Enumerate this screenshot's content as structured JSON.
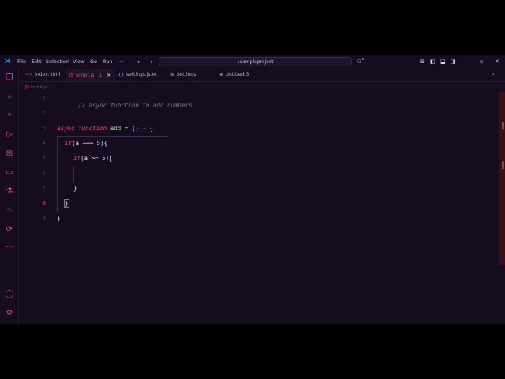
{
  "menu": {
    "file": "File",
    "edit": "Edit",
    "selection": "Selection",
    "view": "View",
    "go": "Go",
    "run": "Run",
    "more": "···"
  },
  "search": {
    "text": "sampleproject"
  },
  "window": {
    "minimize": "–",
    "restore": "▫",
    "close": "✕"
  },
  "tabs": [
    {
      "label": "index.html",
      "icon": "<>"
    },
    {
      "label": "script.js",
      "badge": "1",
      "icon": "JS",
      "close": "✕"
    },
    {
      "label": "settings.json",
      "icon": "{}"
    },
    {
      "label": "Settings",
      "icon": "≡"
    },
    {
      "label": "Untitled-3",
      "icon": "≡"
    }
  ],
  "breadcrumb": {
    "folder": "JS",
    "file": "script.js",
    "sep": "›"
  },
  "editor": {
    "line_numbers": [
      "1",
      "2",
      "3",
      "4",
      "5",
      "6",
      "7",
      "8",
      "9"
    ],
    "current_line": "8",
    "line1": {
      "comment": "// async function to add numbers"
    },
    "line3": {
      "kw1": "async",
      "kw2": "function",
      "name": "add",
      "rest": " = () ",
      "arrow": "⇒",
      "brace": " {"
    },
    "line4": {
      "kw": "if",
      "open": "(a ",
      "strike": "!==",
      "num": " 5",
      "close": "){"
    },
    "line5": {
      "kw": "if",
      "open": "(a >= ",
      "num": "5",
      "close": "){"
    },
    "line7": {
      "text": "}"
    },
    "line8": {
      "text": "}"
    },
    "line9": {
      "text": "}"
    }
  },
  "colors": {
    "accent": "#ff3d6e",
    "background": "#150d1f",
    "function": "#8fe38f",
    "comment": "#7b6f8e"
  },
  "activity_icons": [
    "files-icon",
    "search-icon",
    "source-control-icon",
    "run-debug-icon",
    "extensions-icon",
    "remote-icon",
    "testing-icon",
    "flame-icon",
    "git-icon",
    "more-icon",
    "account-icon",
    "settings-gear-icon"
  ]
}
